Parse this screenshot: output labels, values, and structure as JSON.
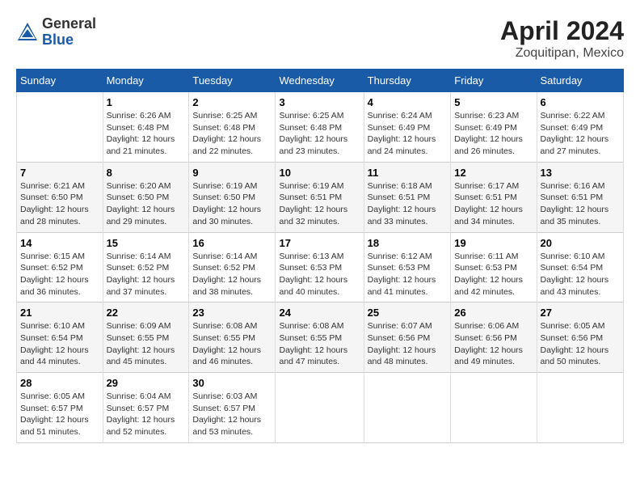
{
  "header": {
    "logo_general": "General",
    "logo_blue": "Blue",
    "month_title": "April 2024",
    "location": "Zoquitipan, Mexico"
  },
  "columns": [
    "Sunday",
    "Monday",
    "Tuesday",
    "Wednesday",
    "Thursday",
    "Friday",
    "Saturday"
  ],
  "weeks": [
    [
      {
        "day": "",
        "info": ""
      },
      {
        "day": "1",
        "info": "Sunrise: 6:26 AM\nSunset: 6:48 PM\nDaylight: 12 hours\nand 21 minutes."
      },
      {
        "day": "2",
        "info": "Sunrise: 6:25 AM\nSunset: 6:48 PM\nDaylight: 12 hours\nand 22 minutes."
      },
      {
        "day": "3",
        "info": "Sunrise: 6:25 AM\nSunset: 6:48 PM\nDaylight: 12 hours\nand 23 minutes."
      },
      {
        "day": "4",
        "info": "Sunrise: 6:24 AM\nSunset: 6:49 PM\nDaylight: 12 hours\nand 24 minutes."
      },
      {
        "day": "5",
        "info": "Sunrise: 6:23 AM\nSunset: 6:49 PM\nDaylight: 12 hours\nand 26 minutes."
      },
      {
        "day": "6",
        "info": "Sunrise: 6:22 AM\nSunset: 6:49 PM\nDaylight: 12 hours\nand 27 minutes."
      }
    ],
    [
      {
        "day": "7",
        "info": "Sunrise: 6:21 AM\nSunset: 6:50 PM\nDaylight: 12 hours\nand 28 minutes."
      },
      {
        "day": "8",
        "info": "Sunrise: 6:20 AM\nSunset: 6:50 PM\nDaylight: 12 hours\nand 29 minutes."
      },
      {
        "day": "9",
        "info": "Sunrise: 6:19 AM\nSunset: 6:50 PM\nDaylight: 12 hours\nand 30 minutes."
      },
      {
        "day": "10",
        "info": "Sunrise: 6:19 AM\nSunset: 6:51 PM\nDaylight: 12 hours\nand 32 minutes."
      },
      {
        "day": "11",
        "info": "Sunrise: 6:18 AM\nSunset: 6:51 PM\nDaylight: 12 hours\nand 33 minutes."
      },
      {
        "day": "12",
        "info": "Sunrise: 6:17 AM\nSunset: 6:51 PM\nDaylight: 12 hours\nand 34 minutes."
      },
      {
        "day": "13",
        "info": "Sunrise: 6:16 AM\nSunset: 6:51 PM\nDaylight: 12 hours\nand 35 minutes."
      }
    ],
    [
      {
        "day": "14",
        "info": "Sunrise: 6:15 AM\nSunset: 6:52 PM\nDaylight: 12 hours\nand 36 minutes."
      },
      {
        "day": "15",
        "info": "Sunrise: 6:14 AM\nSunset: 6:52 PM\nDaylight: 12 hours\nand 37 minutes."
      },
      {
        "day": "16",
        "info": "Sunrise: 6:14 AM\nSunset: 6:52 PM\nDaylight: 12 hours\nand 38 minutes."
      },
      {
        "day": "17",
        "info": "Sunrise: 6:13 AM\nSunset: 6:53 PM\nDaylight: 12 hours\nand 40 minutes."
      },
      {
        "day": "18",
        "info": "Sunrise: 6:12 AM\nSunset: 6:53 PM\nDaylight: 12 hours\nand 41 minutes."
      },
      {
        "day": "19",
        "info": "Sunrise: 6:11 AM\nSunset: 6:53 PM\nDaylight: 12 hours\nand 42 minutes."
      },
      {
        "day": "20",
        "info": "Sunrise: 6:10 AM\nSunset: 6:54 PM\nDaylight: 12 hours\nand 43 minutes."
      }
    ],
    [
      {
        "day": "21",
        "info": "Sunrise: 6:10 AM\nSunset: 6:54 PM\nDaylight: 12 hours\nand 44 minutes."
      },
      {
        "day": "22",
        "info": "Sunrise: 6:09 AM\nSunset: 6:55 PM\nDaylight: 12 hours\nand 45 minutes."
      },
      {
        "day": "23",
        "info": "Sunrise: 6:08 AM\nSunset: 6:55 PM\nDaylight: 12 hours\nand 46 minutes."
      },
      {
        "day": "24",
        "info": "Sunrise: 6:08 AM\nSunset: 6:55 PM\nDaylight: 12 hours\nand 47 minutes."
      },
      {
        "day": "25",
        "info": "Sunrise: 6:07 AM\nSunset: 6:56 PM\nDaylight: 12 hours\nand 48 minutes."
      },
      {
        "day": "26",
        "info": "Sunrise: 6:06 AM\nSunset: 6:56 PM\nDaylight: 12 hours\nand 49 minutes."
      },
      {
        "day": "27",
        "info": "Sunrise: 6:05 AM\nSunset: 6:56 PM\nDaylight: 12 hours\nand 50 minutes."
      }
    ],
    [
      {
        "day": "28",
        "info": "Sunrise: 6:05 AM\nSunset: 6:57 PM\nDaylight: 12 hours\nand 51 minutes."
      },
      {
        "day": "29",
        "info": "Sunrise: 6:04 AM\nSunset: 6:57 PM\nDaylight: 12 hours\nand 52 minutes."
      },
      {
        "day": "30",
        "info": "Sunrise: 6:03 AM\nSunset: 6:57 PM\nDaylight: 12 hours\nand 53 minutes."
      },
      {
        "day": "",
        "info": ""
      },
      {
        "day": "",
        "info": ""
      },
      {
        "day": "",
        "info": ""
      },
      {
        "day": "",
        "info": ""
      }
    ]
  ]
}
